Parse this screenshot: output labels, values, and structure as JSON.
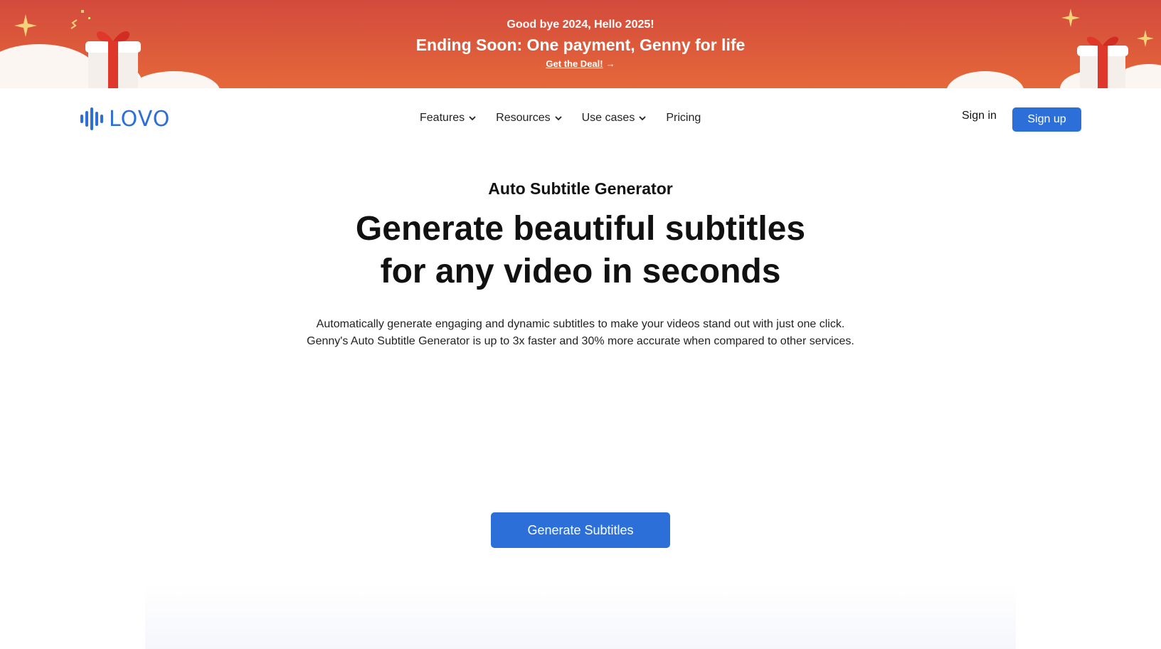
{
  "promo": {
    "line1": "Good bye 2024, Hello 2025!",
    "line2": "Ending Soon: One payment, Genny for life",
    "link": "Get the Deal!",
    "arrow": "→"
  },
  "header": {
    "logo_text": "LOVO",
    "nav": [
      {
        "label": "Features",
        "has_dropdown": true
      },
      {
        "label": "Resources",
        "has_dropdown": true
      },
      {
        "label": "Use cases",
        "has_dropdown": true
      },
      {
        "label": "Pricing",
        "has_dropdown": false
      }
    ],
    "sign_in": "Sign in",
    "sign_up": "Sign up"
  },
  "hero": {
    "eyebrow": "Auto Subtitle Generator",
    "headline_line1": "Generate beautiful subtitles",
    "headline_line2": "for any video in seconds",
    "subtext_line1": "Automatically generate engaging and dynamic subtitles to make your videos stand out with just one click.",
    "subtext_line2": "Genny's Auto Subtitle Generator is up to 3x faster and 30% more accurate when compared to other services.",
    "cta": "Generate Subtitles"
  },
  "colors": {
    "accent": "#2d6fd9",
    "banner_top": "#d34a3c",
    "banner_bottom": "#e5683a"
  }
}
